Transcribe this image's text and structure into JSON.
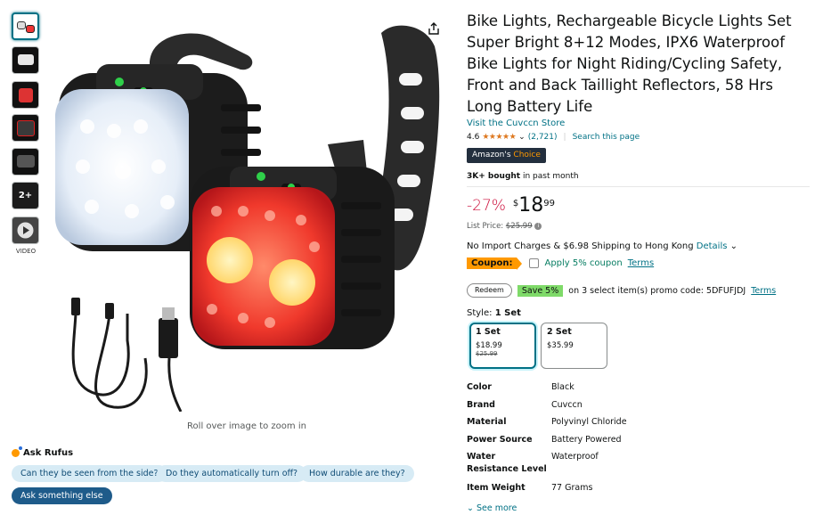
{
  "product": {
    "title": "Bike Lights, Rechargeable Bicycle Lights Set Super Bright 8+12 Modes, IPX6 Waterproof Bike Lights for Night Riding/Cycling Safety, Front and Back Taillight Reflectors, 58 Hrs Long Battery Life",
    "store_link": "Visit the Cuvccn Store",
    "rating_value": "4.6",
    "stars_glyph": "★★★★★",
    "ratings_count": "(2,721)",
    "search_page": "Search this page",
    "badge_prefix": "Amazon's",
    "badge_suffix": "Choice",
    "bought_strong": "3K+ bought",
    "bought_rest": "in past month"
  },
  "price": {
    "discount": "-27%",
    "currency": "$",
    "whole": "18",
    "fraction": "99",
    "list_label": "List Price:",
    "list_value": "$25.99",
    "info_icon": "i"
  },
  "shipping": {
    "text": "No Import Charges & $6.98 Shipping to Hong Kong",
    "details": "Details"
  },
  "coupon": {
    "tag": "Coupon:",
    "apply": "Apply 5% coupon",
    "terms": "Terms"
  },
  "promo": {
    "redeem": "Redeem",
    "save": "Save 5%",
    "text": "on 3 select item(s) promo code: 5DFUFJDJ",
    "terms": "Terms"
  },
  "style": {
    "label": "Style:",
    "selected": "1 Set",
    "options": [
      {
        "name": "1 Set",
        "price": "$18.99",
        "old": "$25.99"
      },
      {
        "name": "2 Set",
        "price": "$35.99"
      }
    ]
  },
  "specs": [
    {
      "k": "Color",
      "v": "Black"
    },
    {
      "k": "Brand",
      "v": "Cuvccn"
    },
    {
      "k": "Material",
      "v": "Polyvinyl Chloride"
    },
    {
      "k": "Power Source",
      "v": "Battery Powered"
    },
    {
      "k": "Water Resistance Level",
      "v": "Waterproof"
    },
    {
      "k": "Item Weight",
      "v": "77 Grams"
    }
  ],
  "see_more": "See more",
  "gallery": {
    "zoom_hint": "Roll over image to zoom in",
    "video_label": "VIDEO",
    "more_count": "2+"
  },
  "rufus": {
    "title": "Ask Rufus",
    "chips": [
      "Can they be seen from the side?",
      "Do they automatically turn off?",
      "How durable are they?"
    ],
    "ask": "Ask something else"
  }
}
